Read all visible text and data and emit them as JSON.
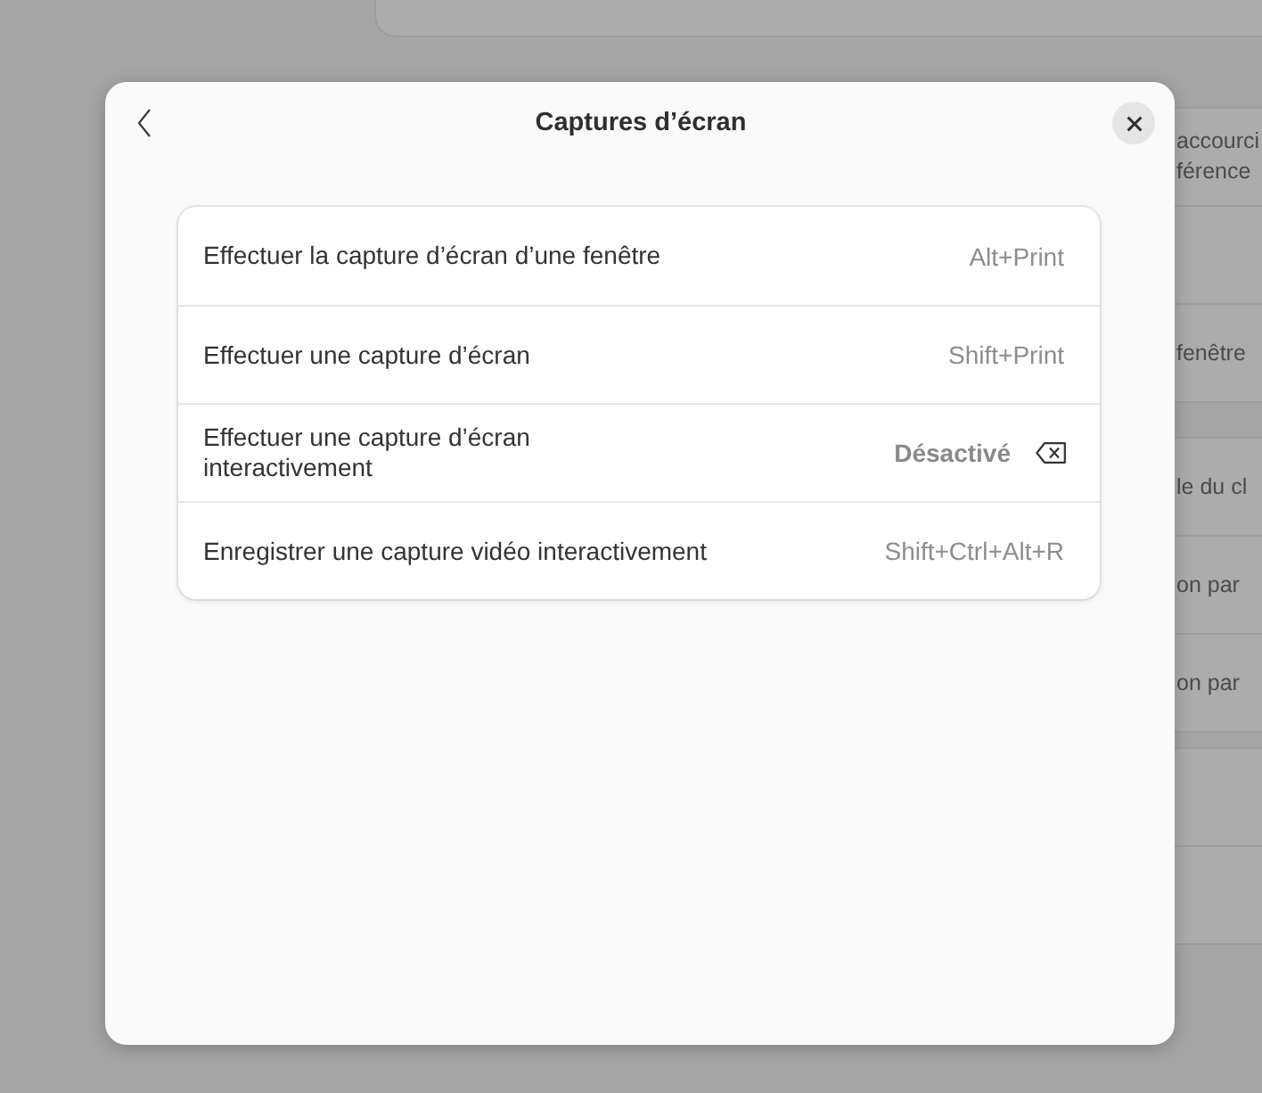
{
  "background": {
    "cards": [
      {
        "kind": "clipped",
        "rows": [
          {
            "kind": "blank"
          }
        ]
      },
      {
        "kind": "whole",
        "rows": [
          {
            "kind": "text",
            "lines": [
              "accourci",
              "férence"
            ]
          },
          {
            "kind": "blank"
          },
          {
            "kind": "text",
            "lines": [
              "fenêtre"
            ]
          }
        ]
      },
      {
        "kind": "whole",
        "rows": [
          {
            "kind": "text",
            "lines": [
              "le du cl"
            ]
          },
          {
            "kind": "text",
            "lines": [
              "on par"
            ]
          },
          {
            "kind": "text",
            "lines": [
              "on par"
            ]
          }
        ]
      },
      {
        "kind": "whole",
        "rows": [
          {
            "kind": "blank"
          },
          {
            "kind": "blank"
          }
        ]
      }
    ]
  },
  "dialog": {
    "title": "Captures d’écran",
    "shortcuts": [
      {
        "kind": "assigned",
        "name": "Effectuer la capture d’écran d’une fenêtre",
        "accelerator": "Alt+Print"
      },
      {
        "kind": "assigned",
        "name": "Effectuer une capture d’écran",
        "accelerator": "Shift+Print"
      },
      {
        "kind": "disabled",
        "name": "Effectuer une capture d’écran interactivement",
        "accelerator": "Désactivé"
      },
      {
        "kind": "assigned",
        "name": "Enregistrer une capture vidéo interactivement",
        "accelerator": "Shift+Ctrl+Alt+R"
      }
    ]
  }
}
